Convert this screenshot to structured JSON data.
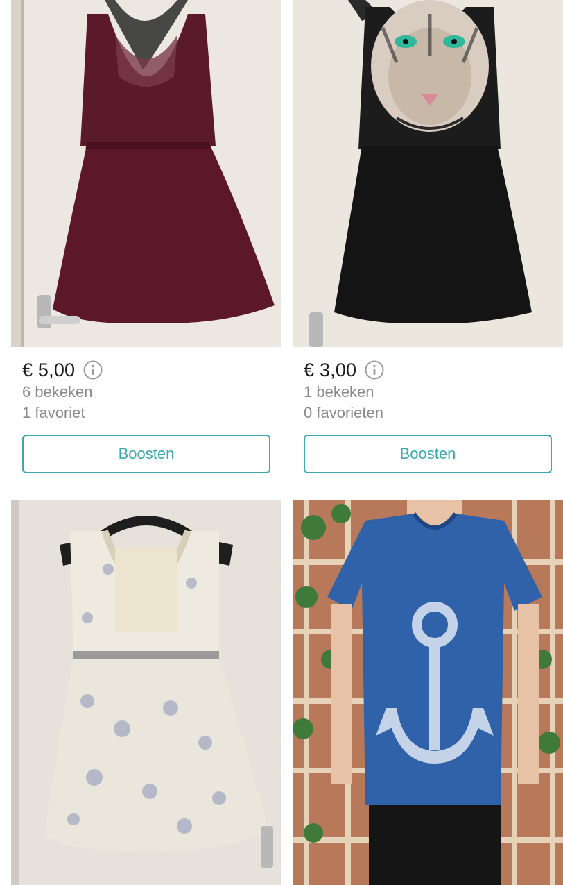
{
  "listings": [
    {
      "image": "burgundy-lace-dress-photo",
      "price": "€ 5,00",
      "views": "6 bekeken",
      "favorites": "1 favoriet",
      "boost_label": "Boosten"
    },
    {
      "image": "black-tiger-print-dress-photo",
      "price": "€ 3,00",
      "views": "1 bekeken",
      "favorites": "0 favorieten",
      "boost_label": "Boosten"
    },
    {
      "image": "floral-cream-dress-photo"
    },
    {
      "image": "blue-anchor-tshirt-photo"
    }
  ],
  "colors": {
    "accent": "#3da8b0",
    "price_text": "#1a1a1a",
    "meta_text": "#8a8a8a"
  },
  "icons": {
    "price_info": "info-circle-icon"
  }
}
